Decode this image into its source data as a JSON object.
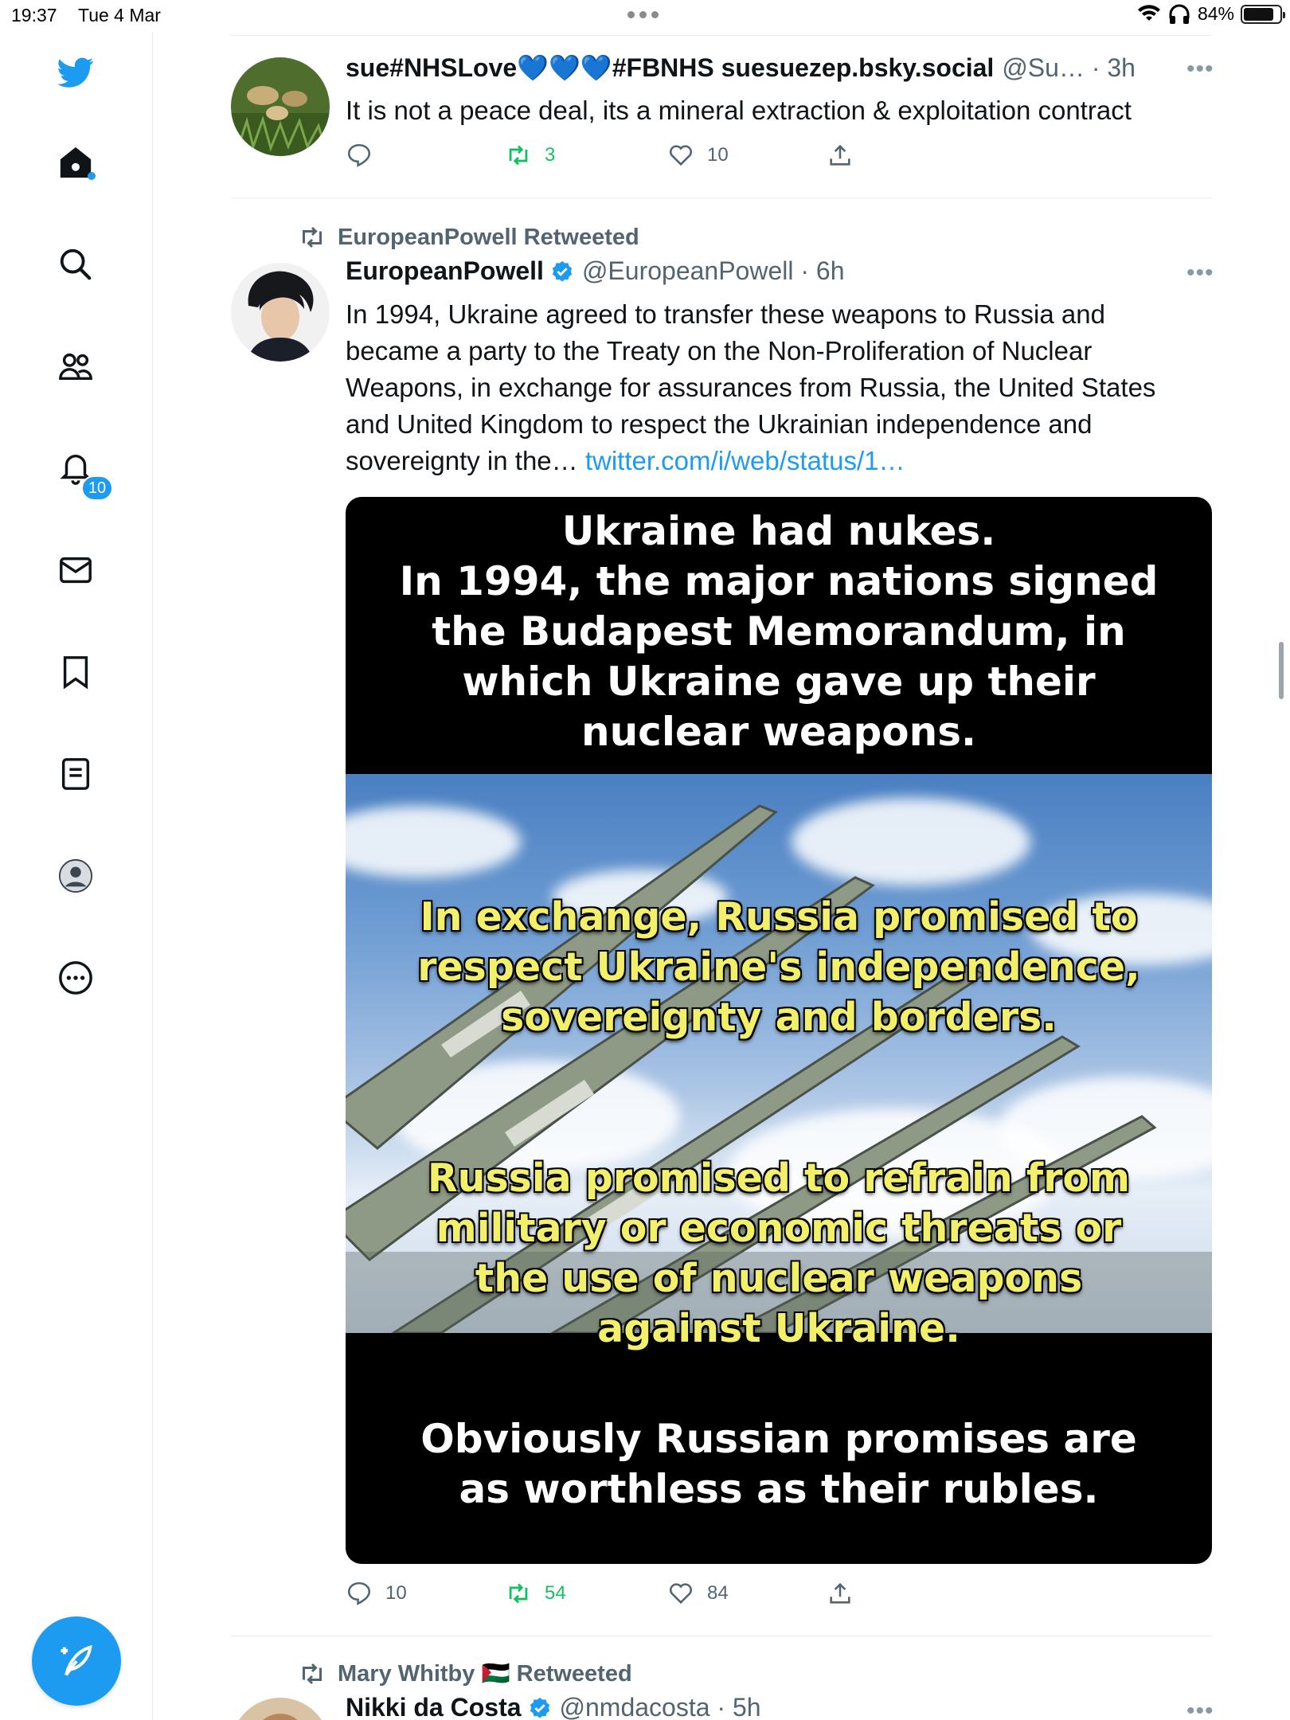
{
  "status_bar": {
    "time": "19:37",
    "date": "Tue 4 Mar",
    "battery": "84%",
    "battery_level": 0.84
  },
  "sidebar": {
    "notifications_badge": "10",
    "items": [
      "twitter-logo",
      "home-icon",
      "search-icon",
      "communities-icon",
      "notifications-icon",
      "messages-icon",
      "bookmarks-icon",
      "lists-icon",
      "profile-icon",
      "more-icon"
    ]
  },
  "colors": {
    "accent": "#1d9bf0",
    "retweet": "#17bf63",
    "muted": "#536471"
  },
  "tweets": [
    {
      "name": "sue#NHSLove💙💙💙#FBNHS suesuezep.bsky.social",
      "handle": "@Su… · 3h",
      "text": "It is not a peace deal, its a mineral extraction & exploitation contract",
      "replies": "",
      "retweets": "3",
      "likes": "10"
    },
    {
      "retweeted_by": "EuropeanPowell Retweeted",
      "name": "EuropeanPowell",
      "verified": true,
      "handle": "@EuropeanPowell · 6h",
      "text": "In 1994, Ukraine agreed to transfer these weapons to Russia and became a party to the Treaty on the Non-Proliferation of Nuclear Weapons, in exchange for assurances from Russia, the United States and United Kingdom to respect the Ukrainian independence and sovereignty in the…",
      "link": "twitter.com/i/web/status/1…",
      "media_text": {
        "top": [
          "Ukraine had nukes.",
          "In 1994, the major nations signed",
          "the Budapest Memorandum, in",
          "which Ukraine gave up their",
          "nuclear weapons."
        ],
        "middle": [
          "In exchange, Russia promised to",
          "respect Ukraine's independence,",
          "sovereignty and borders."
        ],
        "lower": [
          "Russia promised to refrain from",
          "military or economic threats or",
          "the use of nuclear weapons",
          "against Ukraine."
        ],
        "bottom": [
          "Obviously Russian promises are",
          "as worthless as their rubles."
        ]
      },
      "replies": "10",
      "retweets": "54",
      "likes": "84"
    },
    {
      "retweeted_by": "Mary Whitby 🇵🇸 Retweeted",
      "name": "Nikki da Costa",
      "verified": true,
      "handle": "@nmdacosta · 5h"
    }
  ]
}
